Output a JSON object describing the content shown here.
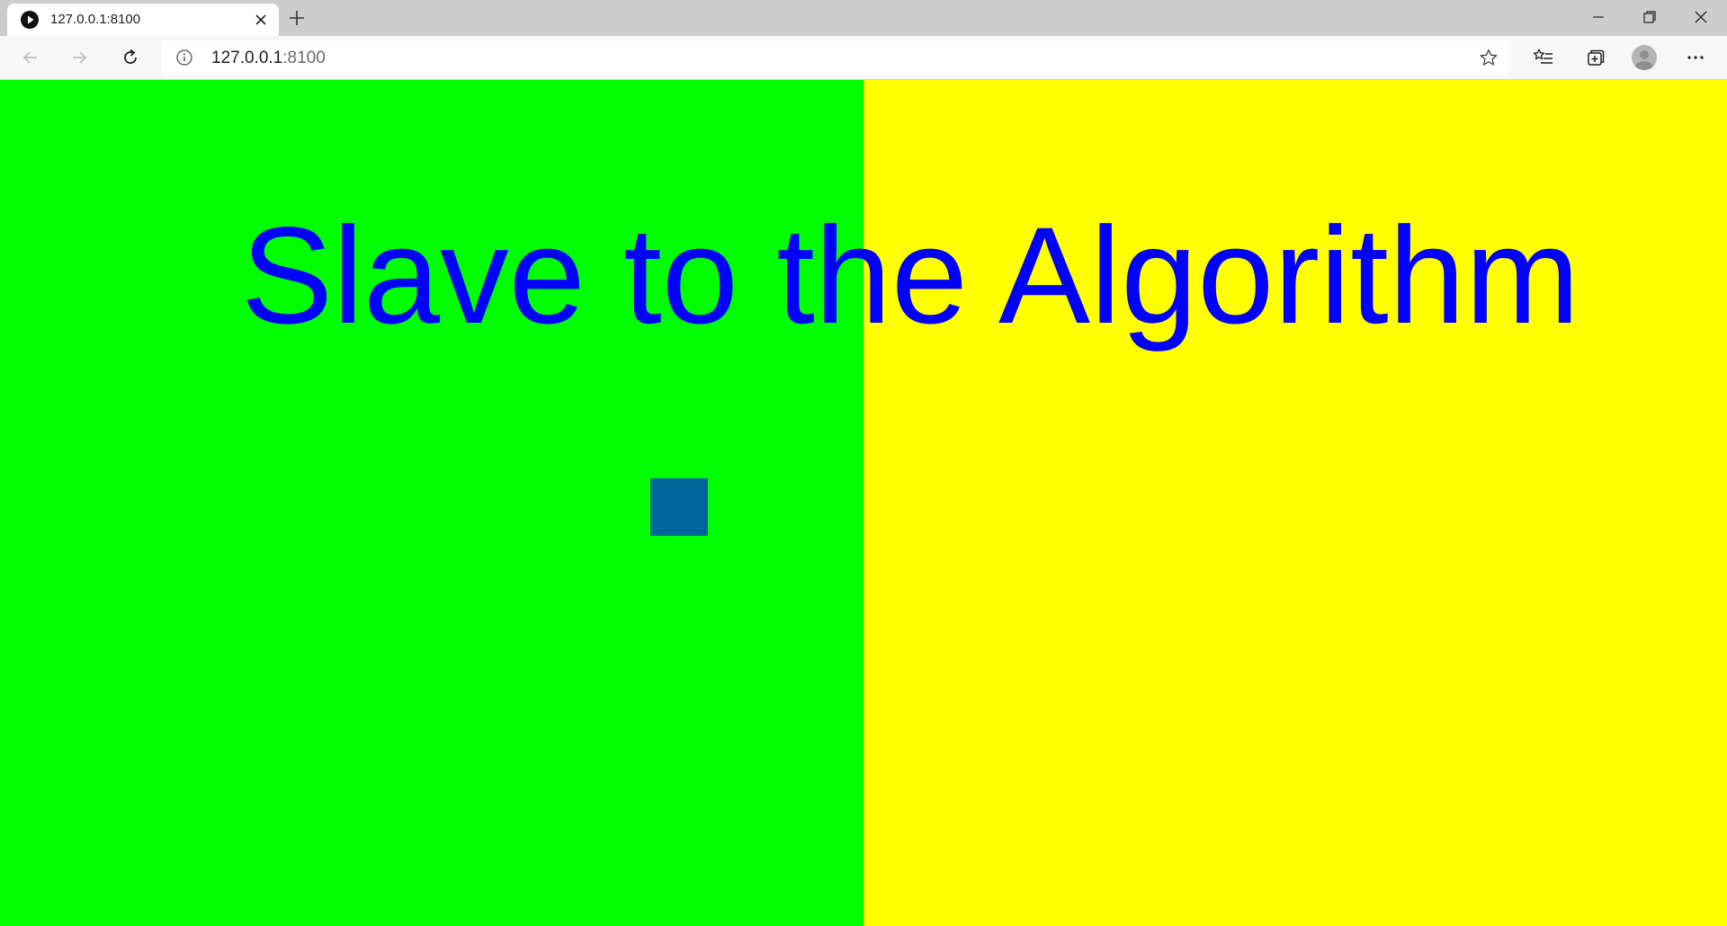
{
  "browser": {
    "tab": {
      "title": "127.0.0.1:8100",
      "favicon": "play-icon"
    },
    "new_tab_icon": "plus-icon",
    "window_controls": [
      "minimize-icon",
      "restore-icon",
      "close-icon"
    ],
    "toolbar": {
      "back_icon": "back-arrow-icon",
      "forward_icon": "forward-arrow-icon",
      "refresh_icon": "refresh-icon",
      "url_host": "127.0.0.1",
      "url_port": ":8100",
      "site_info_icon": "info-icon",
      "favorite_icon": "star-icon",
      "favorites_icon": "favorites-list-icon",
      "collections_icon": "collections-icon",
      "profile_icon": "profile-avatar-icon",
      "menu_icon": "more-menu-icon"
    }
  },
  "page": {
    "title": "Slave to the Algorithm",
    "colors": {
      "left_pane": "#00ff00",
      "right_pane": "#ffff00",
      "title": "#0000ff",
      "player_box": "#006699"
    }
  }
}
